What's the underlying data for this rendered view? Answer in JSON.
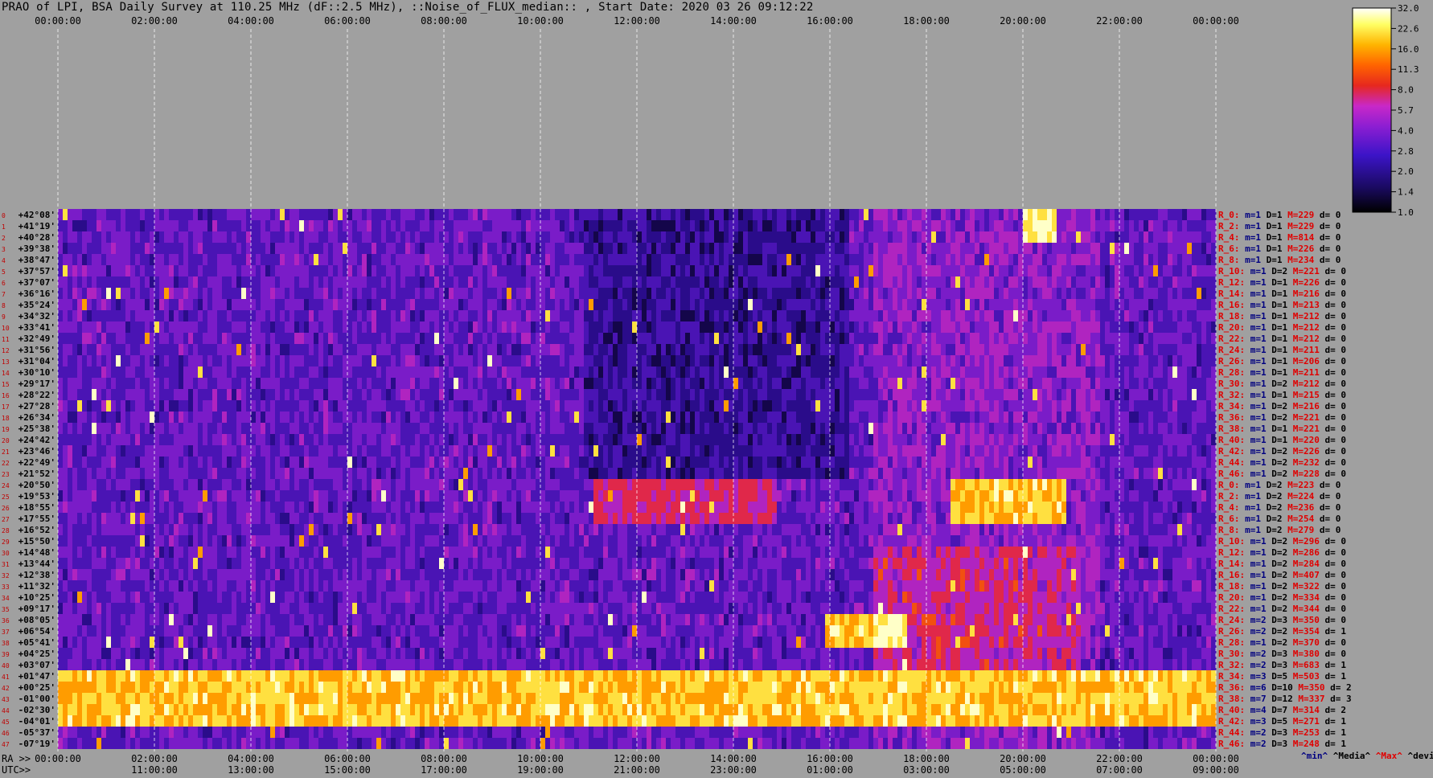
{
  "header": {
    "title": "PRAO of LPI, BSA Daily Survey at 110.25 MHz (dF::2.5 MHz), ::Noise_of_FLUX_median:: , Start Date: 2020 03 26 09:12:22"
  },
  "colorbar": {
    "ticks": [
      "32.0",
      "22.6",
      "16.0",
      "11.3",
      "8.0",
      "5.7",
      "4.0",
      "2.8",
      "2.0",
      "1.4",
      "1.0"
    ],
    "colormap": [
      "#000000",
      "#1a0a60",
      "#3c14c8",
      "#8c1ed2",
      "#c828c8",
      "#e6281e",
      "#ff6400",
      "#ffb400",
      "#ffff64",
      "#ffffff"
    ]
  },
  "axes": {
    "ra_prefix": "RA >>",
    "utc_prefix": "UTC>>",
    "ra_ticks": [
      "00:00:00",
      "02:00:00",
      "04:00:00",
      "06:00:00",
      "08:00:00",
      "10:00:00",
      "12:00:00",
      "14:00:00",
      "16:00:00",
      "18:00:00",
      "20:00:00",
      "22:00:00",
      "00:00:00"
    ],
    "utc_ticks": [
      "11:00:00",
      "13:00:00",
      "15:00:00",
      "17:00:00",
      "19:00:00",
      "21:00:00",
      "23:00:00",
      "01:00:00",
      "03:00:00",
      "05:00:00",
      "07:00:00",
      "09:00:00"
    ],
    "dec_labels": [
      "+42°08'",
      "+41°19'",
      "+40°28'",
      "+39°38'",
      "+38°47'",
      "+37°57'",
      "+37°07'",
      "+36°16'",
      "+35°24'",
      "+34°32'",
      "+33°41'",
      "+32°49'",
      "+31°56'",
      "+31°04'",
      "+30°10'",
      "+29°17'",
      "+28°22'",
      "+27°28'",
      "+26°34'",
      "+25°38'",
      "+24°42'",
      "+23°46'",
      "+22°49'",
      "+21°52'",
      "+20°50'",
      "+19°53'",
      "+18°55'",
      "+17°55'",
      "+16°52'",
      "+15°50'",
      "+14°48'",
      "+13°44'",
      "+12°38'",
      "+11°32'",
      "+10°25'",
      "+09°17'",
      "+08°05'",
      "+06°54'",
      "+05°41'",
      "+04°25'",
      "+03°07'",
      "+01°47'",
      "+00°25'",
      "-01°00'",
      "-02°30'",
      "-04°01'",
      "-05°37'",
      "-07°19'"
    ]
  },
  "chart_data": {
    "type": "heatmap",
    "title": "PRAO of LPI, BSA Daily Survey at 110.25 MHz (dF::2.5 MHz), ::Noise_of_FLUX_median:: , Start Date: 2020 03 26 09:12:22",
    "x_ra_range": [
      "00:00:00",
      "00:00:00"
    ],
    "colorbar_range": [
      1.0,
      32.0
    ],
    "colorbar_scale": "log",
    "grid": true,
    "rows": 48,
    "regions": [
      {
        "rows": [
          41,
          45
        ],
        "x": [
          0,
          1.0
        ],
        "level": "high"
      },
      {
        "rows": [
          24,
          27
        ],
        "x": [
          0.46,
          0.62
        ],
        "level": "medium"
      },
      {
        "rows": [
          24,
          27
        ],
        "x": [
          0.77,
          0.87
        ],
        "level": "high"
      },
      {
        "rows": [
          0,
          2
        ],
        "x": [
          0.83,
          0.86
        ],
        "level": "very-high"
      },
      {
        "rows": [
          36,
          38
        ],
        "x": [
          0.66,
          0.73
        ],
        "level": "high"
      }
    ],
    "summary": [
      {
        "label": "R_0:",
        "min": "m=1",
        "dev": "D=1",
        "max": "M=229",
        "d": "d= 0"
      },
      {
        "label": "R_2:",
        "min": "m=1",
        "dev": "D=1",
        "max": "M=229",
        "d": "d= 0"
      },
      {
        "label": "R_4:",
        "min": "m=1",
        "dev": "D=1",
        "max": "M=814",
        "d": "d= 0"
      },
      {
        "label": "R_6:",
        "min": "m=1",
        "dev": "D=1",
        "max": "M=226",
        "d": "d= 0"
      },
      {
        "label": "R_8:",
        "min": "m=1",
        "dev": "D=1",
        "max": "M=234",
        "d": "d= 0"
      },
      {
        "label": "R_10:",
        "min": "m=1",
        "dev": "D=2",
        "max": "M=221",
        "d": "d= 0"
      },
      {
        "label": "R_12:",
        "min": "m=1",
        "dev": "D=1",
        "max": "M=226",
        "d": "d= 0"
      },
      {
        "label": "R_14:",
        "min": "m=1",
        "dev": "D=1",
        "max": "M=216",
        "d": "d= 0"
      },
      {
        "label": "R_16:",
        "min": "m=1",
        "dev": "D=1",
        "max": "M=213",
        "d": "d= 0"
      },
      {
        "label": "R_18:",
        "min": "m=1",
        "dev": "D=1",
        "max": "M=212",
        "d": "d= 0"
      },
      {
        "label": "R_20:",
        "min": "m=1",
        "dev": "D=1",
        "max": "M=212",
        "d": "d= 0"
      },
      {
        "label": "R_22:",
        "min": "m=1",
        "dev": "D=1",
        "max": "M=212",
        "d": "d= 0"
      },
      {
        "label": "R_24:",
        "min": "m=1",
        "dev": "D=1",
        "max": "M=211",
        "d": "d= 0"
      },
      {
        "label": "R_26:",
        "min": "m=1",
        "dev": "D=1",
        "max": "M=206",
        "d": "d= 0"
      },
      {
        "label": "R_28:",
        "min": "m=1",
        "dev": "D=1",
        "max": "M=211",
        "d": "d= 0"
      },
      {
        "label": "R_30:",
        "min": "m=1",
        "dev": "D=2",
        "max": "M=212",
        "d": "d= 0"
      },
      {
        "label": "R_32:",
        "min": "m=1",
        "dev": "D=1",
        "max": "M=215",
        "d": "d= 0"
      },
      {
        "label": "R_34:",
        "min": "m=1",
        "dev": "D=2",
        "max": "M=216",
        "d": "d= 0"
      },
      {
        "label": "R_36:",
        "min": "m=1",
        "dev": "D=2",
        "max": "M=221",
        "d": "d= 0"
      },
      {
        "label": "R_38:",
        "min": "m=1",
        "dev": "D=1",
        "max": "M=221",
        "d": "d= 0"
      },
      {
        "label": "R_40:",
        "min": "m=1",
        "dev": "D=1",
        "max": "M=220",
        "d": "d= 0"
      },
      {
        "label": "R_42:",
        "min": "m=1",
        "dev": "D=2",
        "max": "M=226",
        "d": "d= 0"
      },
      {
        "label": "R_44:",
        "min": "m=1",
        "dev": "D=2",
        "max": "M=232",
        "d": "d= 0"
      },
      {
        "label": "R_46:",
        "min": "m=1",
        "dev": "D=2",
        "max": "M=228",
        "d": "d= 0"
      },
      {
        "label": "R_0:",
        "min": "m=1",
        "dev": "D=2",
        "max": "M=223",
        "d": "d= 0"
      },
      {
        "label": "R_2:",
        "min": "m=1",
        "dev": "D=2",
        "max": "M=224",
        "d": "d= 0"
      },
      {
        "label": "R_4:",
        "min": "m=1",
        "dev": "D=2",
        "max": "M=236",
        "d": "d= 0"
      },
      {
        "label": "R_6:",
        "min": "m=1",
        "dev": "D=2",
        "max": "M=254",
        "d": "d= 0"
      },
      {
        "label": "R_8:",
        "min": "m=1",
        "dev": "D=2",
        "max": "M=279",
        "d": "d= 0"
      },
      {
        "label": "R_10:",
        "min": "m=1",
        "dev": "D=2",
        "max": "M=296",
        "d": "d= 0"
      },
      {
        "label": "R_12:",
        "min": "m=1",
        "dev": "D=2",
        "max": "M=286",
        "d": "d= 0"
      },
      {
        "label": "R_14:",
        "min": "m=1",
        "dev": "D=2",
        "max": "M=284",
        "d": "d= 0"
      },
      {
        "label": "R_16:",
        "min": "m=1",
        "dev": "D=2",
        "max": "M=407",
        "d": "d= 0"
      },
      {
        "label": "R_18:",
        "min": "m=1",
        "dev": "D=2",
        "max": "M=322",
        "d": "d= 0"
      },
      {
        "label": "R_20:",
        "min": "m=1",
        "dev": "D=2",
        "max": "M=334",
        "d": "d= 0"
      },
      {
        "label": "R_22:",
        "min": "m=1",
        "dev": "D=2",
        "max": "M=344",
        "d": "d= 0"
      },
      {
        "label": "R_24:",
        "min": "m=2",
        "dev": "D=3",
        "max": "M=350",
        "d": "d= 0"
      },
      {
        "label": "R_26:",
        "min": "m=2",
        "dev": "D=2",
        "max": "M=354",
        "d": "d= 1"
      },
      {
        "label": "R_28:",
        "min": "m=1",
        "dev": "D=2",
        "max": "M=370",
        "d": "d= 0"
      },
      {
        "label": "R_30:",
        "min": "m=2",
        "dev": "D=3",
        "max": "M=380",
        "d": "d= 0"
      },
      {
        "label": "R_32:",
        "min": "m=2",
        "dev": "D=3",
        "max": "M=683",
        "d": "d= 1"
      },
      {
        "label": "R_34:",
        "min": "m=3",
        "dev": "D=5",
        "max": "M=503",
        "d": "d= 1"
      },
      {
        "label": "R_36:",
        "min": "m=6",
        "dev": "D=10",
        "max": "M=350",
        "d": "d= 2"
      },
      {
        "label": "R_38:",
        "min": "m=7",
        "dev": "D=12",
        "max": "M=337",
        "d": "d= 3"
      },
      {
        "label": "R_40:",
        "min": "m=4",
        "dev": "D=7",
        "max": "M=314",
        "d": "d= 2"
      },
      {
        "label": "R_42:",
        "min": "m=3",
        "dev": "D=5",
        "max": "M=271",
        "d": "d= 1"
      },
      {
        "label": "R_44:",
        "min": "m=2",
        "dev": "D=3",
        "max": "M=253",
        "d": "d= 1"
      },
      {
        "label": "R_46:",
        "min": "m=2",
        "dev": "D=3",
        "max": "M=248",
        "d": "d= 1"
      }
    ],
    "legend": [
      "^min^",
      "^Media^",
      "^Max^",
      "^devia^"
    ]
  }
}
